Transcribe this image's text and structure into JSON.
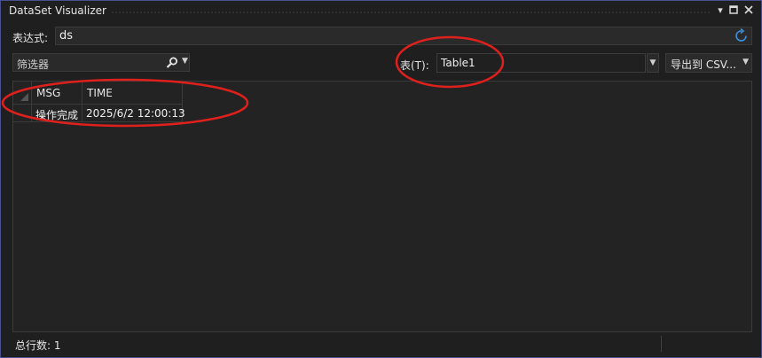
{
  "window": {
    "title": "DataSet Visualizer"
  },
  "expression": {
    "label": "表达式:",
    "value": "ds"
  },
  "filter": {
    "placeholder": "筛选器"
  },
  "table": {
    "label": "表(T):",
    "selected": "Table1"
  },
  "export": {
    "label": "导出到 CSV..."
  },
  "grid": {
    "columns": [
      "MSG",
      "TIME"
    ],
    "rows": [
      [
        "操作完成",
        "2025/6/2 12:00:13"
      ]
    ]
  },
  "status": {
    "text": "总行数: 1"
  },
  "colors": {
    "annotation": "#e0201c",
    "border": "#4a4f8f",
    "accent_refresh": "#3c8fdc"
  },
  "icons": [
    "pin-icon",
    "maximize-icon",
    "close-icon",
    "refresh-icon",
    "search-icon",
    "chevron-down-icon"
  ]
}
